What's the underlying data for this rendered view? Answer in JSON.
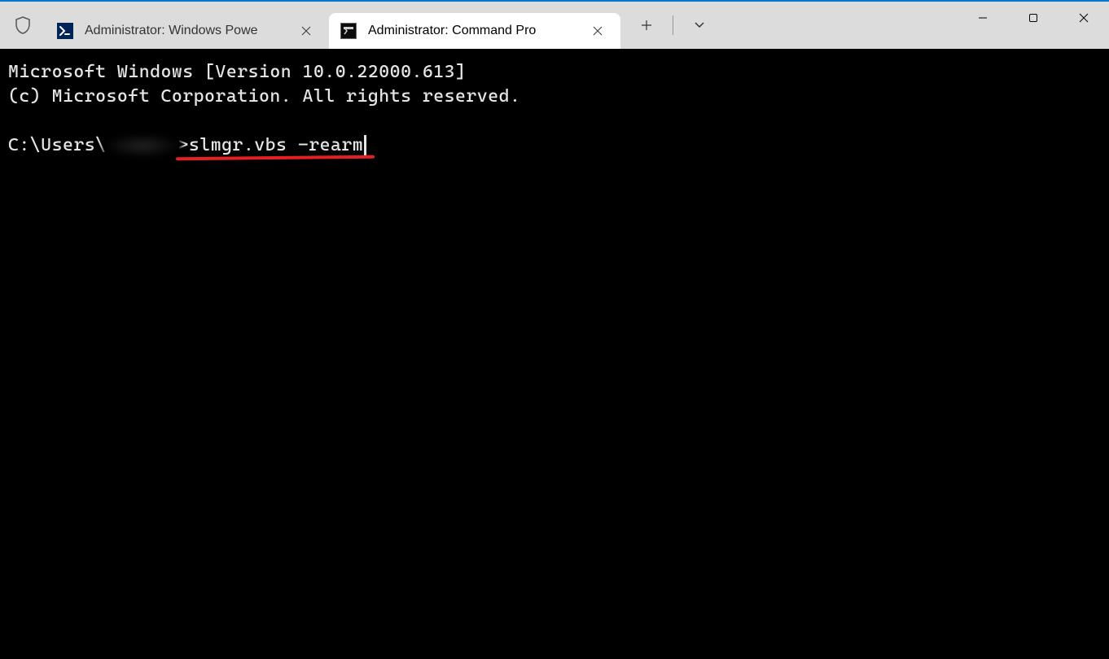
{
  "tabs": [
    {
      "title": "Administrator: Windows Powe",
      "active": false,
      "iconType": "powershell"
    },
    {
      "title": "Administrator: Command Pro",
      "active": true,
      "iconType": "cmd"
    }
  ],
  "terminal": {
    "line1": "Microsoft Windows [Version 10.0.22000.613]",
    "line2": "(c) Microsoft Corporation. All rights reserved.",
    "promptPrefix": "C:\\Users\\",
    "promptSuffix": ">",
    "command": "slmgr.vbs -rearm"
  },
  "annotation": {
    "underlineColor": "#e62020"
  }
}
